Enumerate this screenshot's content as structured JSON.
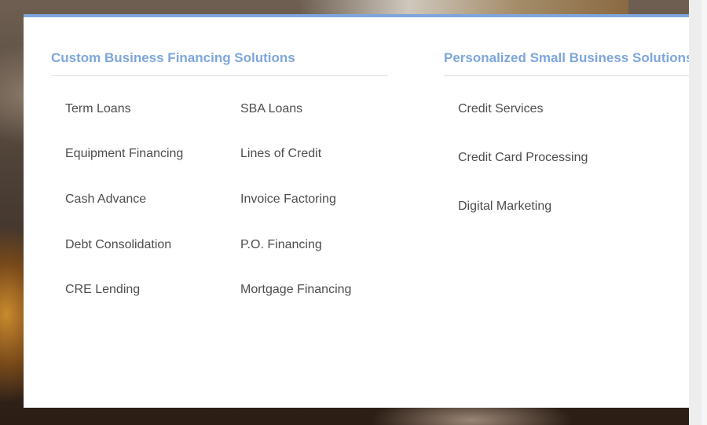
{
  "menu": {
    "financing": {
      "title": "Custom Business Financing Solutions",
      "left_links": [
        "Term Loans",
        "Equipment Financing",
        "Cash Advance",
        "Debt Consolidation",
        "CRE Lending"
      ],
      "right_links": [
        "SBA Loans",
        "Lines of Credit",
        "Invoice Factoring",
        "P.O. Financing",
        "Mortgage Financing"
      ]
    },
    "services": {
      "title": "Personalized Small Business Solutions",
      "links": [
        "Credit Services",
        "Credit Card Processing",
        "Digital Marketing"
      ]
    }
  },
  "colors": {
    "accent": "#7ea6dc",
    "link_text": "#4d4d4d",
    "divider": "#dedede"
  }
}
